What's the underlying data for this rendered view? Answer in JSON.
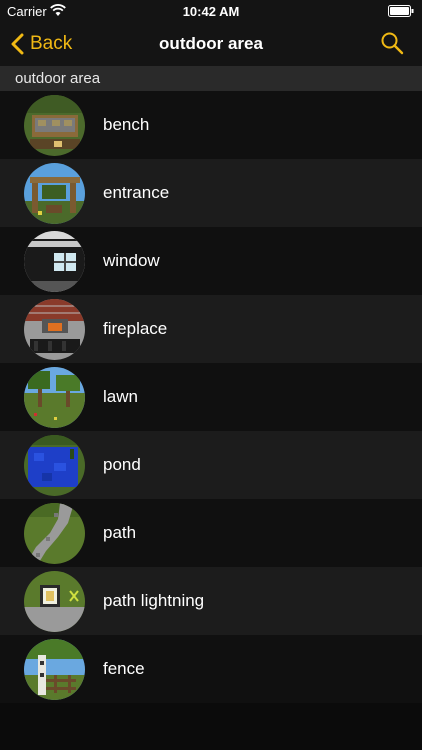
{
  "status_bar": {
    "carrier": "Carrier",
    "time": "10:42 AM",
    "wifi_icon": "wifi-icon",
    "battery_icon": "battery-icon"
  },
  "nav": {
    "back_label": "Back",
    "title": "outdoor area",
    "search_icon": "search-icon",
    "accent_color": "#f0b914"
  },
  "section": {
    "title": "outdoor area"
  },
  "items": [
    {
      "label": "bench",
      "thumbnail": "bench-thumbnail"
    },
    {
      "label": "entrance",
      "thumbnail": "entrance-thumbnail"
    },
    {
      "label": "window",
      "thumbnail": "window-thumbnail"
    },
    {
      "label": "fireplace",
      "thumbnail": "fireplace-thumbnail"
    },
    {
      "label": "lawn",
      "thumbnail": "lawn-thumbnail"
    },
    {
      "label": "pond",
      "thumbnail": "pond-thumbnail"
    },
    {
      "label": "path",
      "thumbnail": "path-thumbnail"
    },
    {
      "label": "path lightning",
      "thumbnail": "path-lightning-thumbnail"
    },
    {
      "label": "fence",
      "thumbnail": "fence-thumbnail"
    }
  ]
}
